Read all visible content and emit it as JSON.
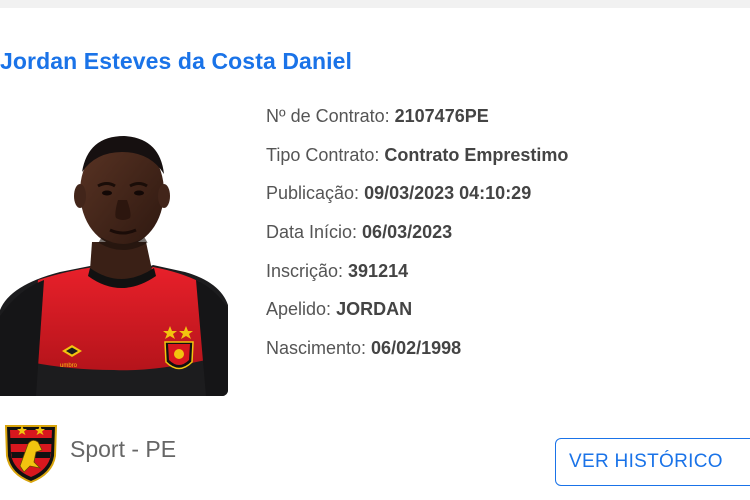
{
  "player": {
    "name": "Jordan Esteves da Costa Daniel"
  },
  "info": [
    {
      "label": "Nº de Contrato: ",
      "value": "2107476PE"
    },
    {
      "label": "Tipo Contrato: ",
      "value": "Contrato Emprestimo"
    },
    {
      "label": "Publicação: ",
      "value": "09/03/2023 04:10:29"
    },
    {
      "label": "Data Início: ",
      "value": "06/03/2023"
    },
    {
      "label": "Inscrição: ",
      "value": "391214"
    },
    {
      "label": "Apelido: ",
      "value": "JORDAN"
    },
    {
      "label": "Nascimento: ",
      "value": "06/02/1998"
    }
  ],
  "club": {
    "name": "Sport - PE",
    "crest_icon": "sport-recife-crest-icon",
    "colors": {
      "red": "#d8171e",
      "black": "#111111",
      "gold": "#f2c40f"
    }
  },
  "actions": {
    "history_label": "VER HISTÓRICO"
  },
  "theme": {
    "accent": "#1a73e8",
    "text": "#555555"
  }
}
